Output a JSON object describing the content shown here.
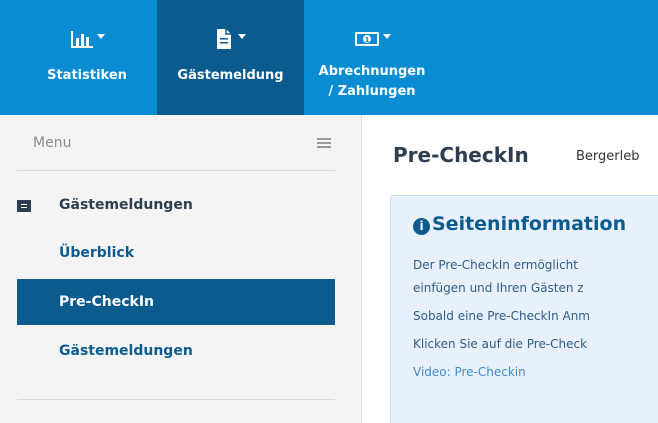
{
  "topnav": {
    "items": [
      {
        "label": "Statistiken",
        "icon": "bar-chart-icon"
      },
      {
        "label": "Gästemeldung",
        "icon": "document-icon"
      },
      {
        "label_line1": "Abrechnungen",
        "label_line2": "/ Zahlungen",
        "icon": "money-icon"
      }
    ]
  },
  "sidebar": {
    "menu_label": "Menu",
    "section_title": "Gästemeldungen",
    "items": [
      {
        "label": "Überblick"
      },
      {
        "label": "Pre-CheckIn"
      },
      {
        "label": "Gästemeldungen"
      }
    ]
  },
  "main": {
    "title": "Pre-CheckIn",
    "subtitle": "Bergerleb",
    "info": {
      "title": "Seiteninformation",
      "lines": [
        "Der Pre-CheckIn ermöglicht",
        "einfügen und Ihren Gästen z",
        "Sobald eine Pre-CheckIn Anm",
        "Klicken Sie auf die Pre-Check",
        "Video: Pre-Checkin"
      ]
    }
  },
  "colors": {
    "topbar": "#0a8cd2",
    "active": "#0c5b8f",
    "sidebar_bg": "#f4f4f4",
    "info_bg": "#e8f1fb"
  }
}
